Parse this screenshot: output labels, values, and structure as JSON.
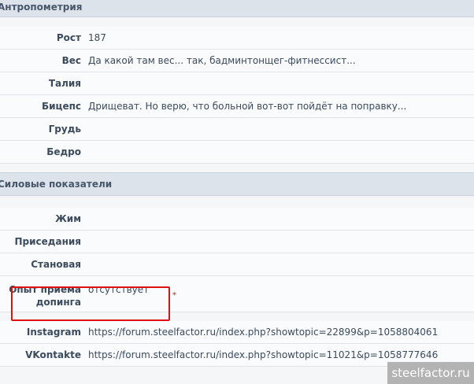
{
  "sections": {
    "anthropometry_title": "Антропометрия",
    "strength_title": "Силовые показатели"
  },
  "anthropometry": [
    {
      "label": "Рост",
      "value": "187"
    },
    {
      "label": "Вес",
      "value": "Да какой там вес... так, бадминтонщег-фитнессист..."
    },
    {
      "label": "Талия",
      "value": ""
    },
    {
      "label": "Бицепс",
      "value": "Дрищеват. Но верю, что больной вот-вот пойдёт на поправку..."
    },
    {
      "label": "Грудь",
      "value": ""
    },
    {
      "label": "Бедро",
      "value": ""
    }
  ],
  "strength": [
    {
      "label": "Жим",
      "value": ""
    },
    {
      "label": "Приседания",
      "value": ""
    },
    {
      "label": "Становая",
      "value": ""
    },
    {
      "label_line1": "Опыт приема",
      "label_line2": "допинга",
      "value": "отсутствует"
    }
  ],
  "social": [
    {
      "label": "Instagram",
      "value": "https://forum.steelfactor.ru/index.php?showtopic=22899&p=1058804061"
    },
    {
      "label": "VKontakte",
      "value": "https://forum.steelfactor.ru/index.php?showtopic=11021&p=1058777646"
    }
  ],
  "annotation": {
    "marker": "*",
    "color": "#e01010"
  },
  "watermark": "steelfactor.ru"
}
